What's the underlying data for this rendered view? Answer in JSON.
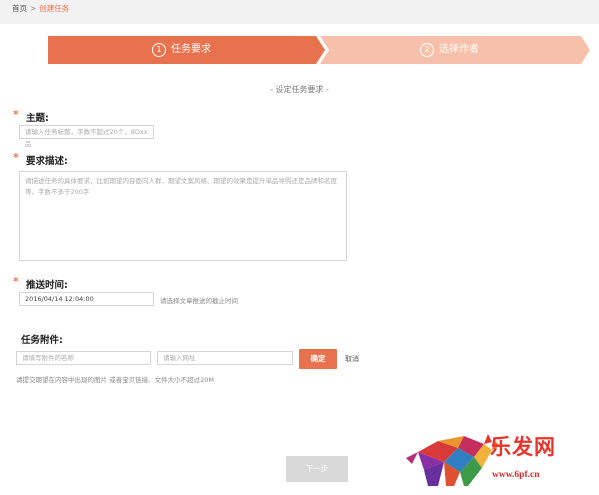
{
  "breadcrumb": {
    "home": "首页",
    "separator": ">",
    "current": "创建任务"
  },
  "steps": [
    {
      "num": "1",
      "label": "任务要求",
      "active": true
    },
    {
      "num": "2",
      "label": "选择作者",
      "active": false
    }
  ],
  "section_title": "- 设定任务要求 -",
  "form": {
    "required_mark": "*",
    "topic": {
      "label": "主题:",
      "placeholder": "请输入任务标题，字数不超过20个，8Dxx品"
    },
    "description": {
      "label": "要求描述:",
      "placeholder": "请描述任务的具体要求，比如期望内容面向人群、期望文案风格、期望的效果是提升单品导购还是品牌和名度等。字数不多于200字"
    },
    "push_time": {
      "label": "推送时间:",
      "value": "2016/04/14 12:04:00",
      "hint": "请选择文章推送的截止时间"
    },
    "attachment": {
      "label": "任务附件:",
      "name_placeholder": "请填写附件的名称",
      "url_placeholder": "请输入网址",
      "confirm_label": "确定",
      "cancel_label": "取消",
      "hint": "请提交期望在内容中出现的图片 或者宝贝链接、文件大小不超过20M"
    }
  },
  "next_button": "下一步",
  "watermark": {
    "brand": "乐发网",
    "url": "www.6pf.cn"
  },
  "colors": {
    "accent": "#e8724d",
    "step_inactive": "#f7c0aa",
    "next_disabled": "#d9d9d9"
  }
}
